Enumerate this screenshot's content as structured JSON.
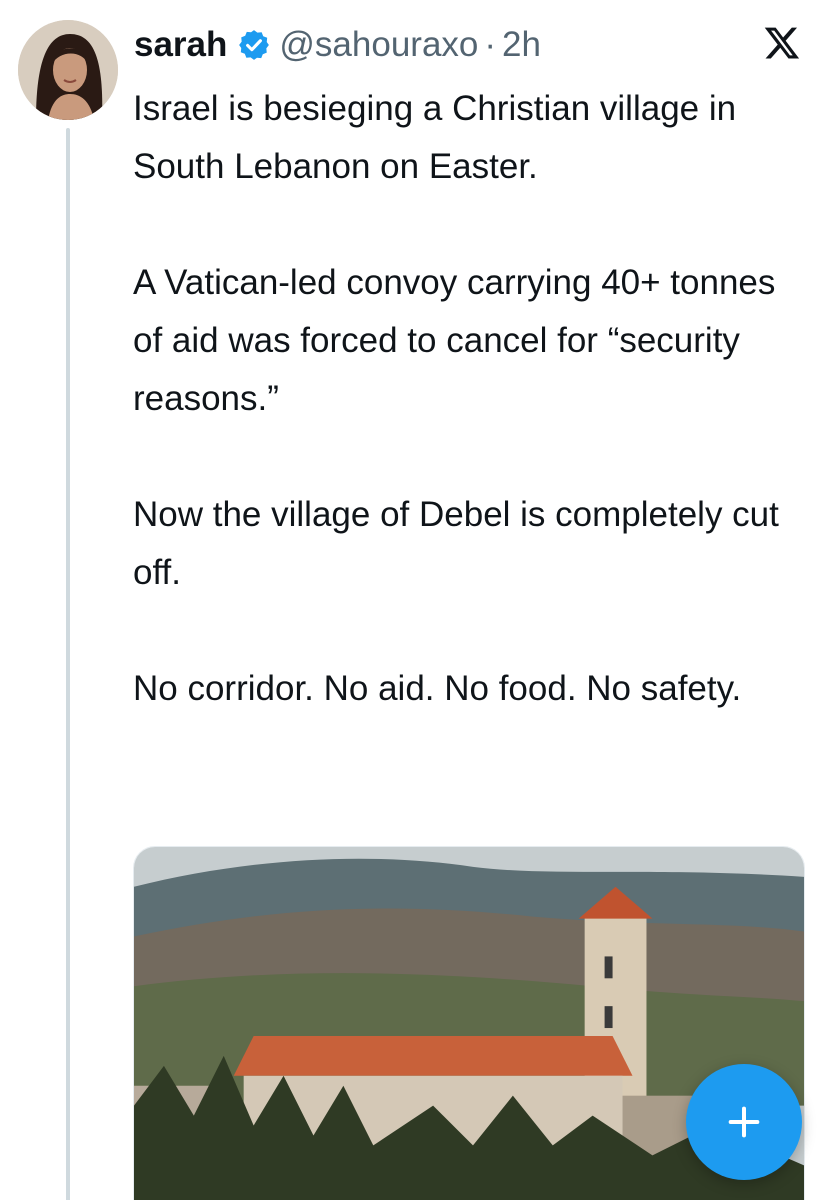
{
  "post": {
    "author": {
      "display_name": "sarah",
      "handle": "@sahouraxo",
      "verified": true,
      "avatar_icon": "profile-photo"
    },
    "separator": "·",
    "time_ago": "2h",
    "platform_icon": "x-logo-icon",
    "paragraphs": [
      "Israel is besieging a Christian village in South Lebanon on Easter.",
      "A Vatican-led convoy carrying 40+ tonnes of aid was forced to cancel for “security reasons.”",
      "Now the village of Debel is completely cut off.",
      "No corridor. No aid. No food. No safety."
    ],
    "media_icon": "church-village-photo"
  },
  "compose_button": {
    "icon": "plus-icon"
  },
  "colors": {
    "text": "#0f1419",
    "secondary": "#536471",
    "verified": "#1d9bf0",
    "fab": "#1d9bf0",
    "thread_line": "#cfd9de"
  }
}
